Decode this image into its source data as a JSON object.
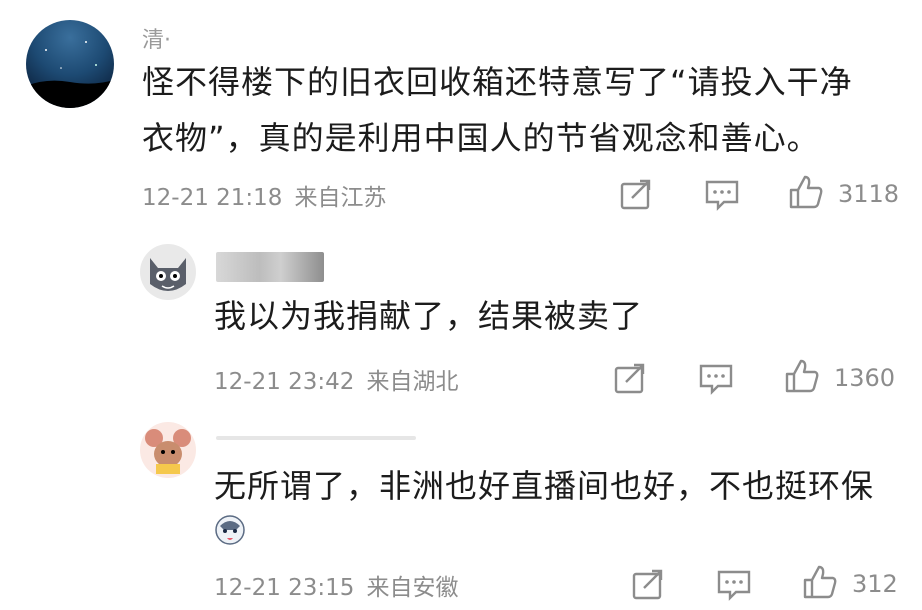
{
  "comments": [
    {
      "username": "清·",
      "text_line1": "怪不得楼下的旧衣回收箱还特意写了“请投入干净",
      "text_line2": "衣物”，真的是利用中国人的节省观念和善心。",
      "time": "12-21 21:18",
      "location": "来自江苏",
      "likes": "3118"
    },
    {
      "username": "",
      "text_line1": "我以为我捐献了，结果被卖了",
      "time": "12-21 23:42",
      "location": "来自湖北",
      "likes": "1360"
    },
    {
      "username": "",
      "text_line1": "无所谓了，非洲也好直播间也好，不也挺环保",
      "time": "12-21 23:15",
      "location": "来自安徽",
      "likes": "312"
    }
  ],
  "icons": {
    "share": "share-icon",
    "reply": "comment-icon",
    "like": "thumbs-up-icon",
    "emoji": "husky-emoji-icon"
  },
  "colors": {
    "text": "#1c1c1c",
    "meta": "#8c8c8c",
    "background": "#ffffff"
  }
}
